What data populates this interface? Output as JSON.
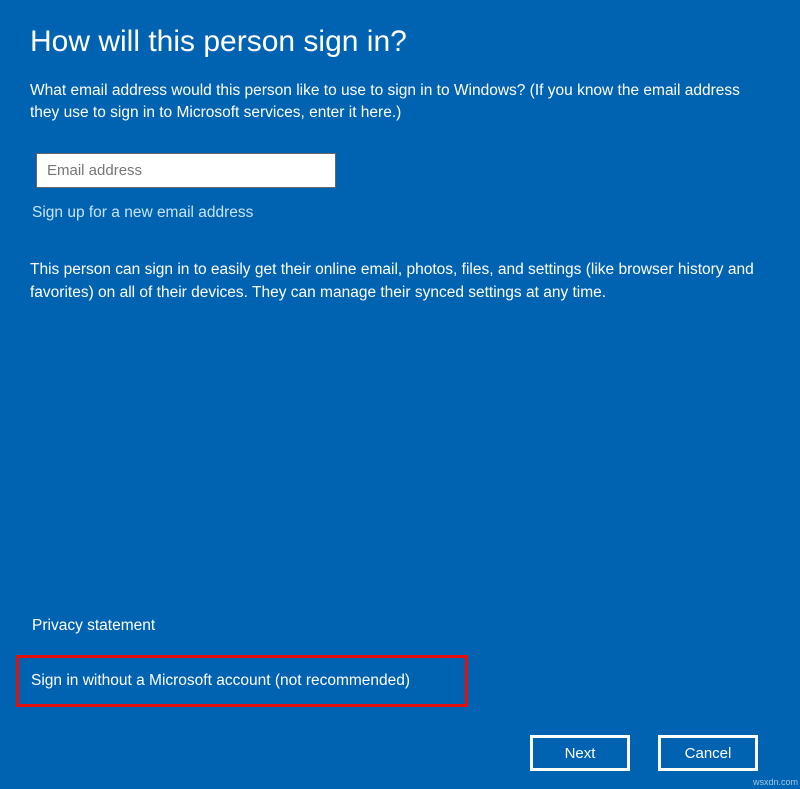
{
  "page": {
    "title": "How will this person sign in?",
    "intro": "What email address would this person like to use to sign in to Windows? (If you know the email address they use to sign in to Microsoft services, enter it here.)",
    "emailPlaceholder": "Email address",
    "signupLink": "Sign up for a new email address",
    "description": "This person can sign in to easily get their online email, photos, files, and settings (like browser history and favorites) on all of their devices. They can manage their synced settings at any time.",
    "privacyLink": "Privacy statement",
    "noMsAccountLink": "Sign in without a Microsoft account (not recommended)"
  },
  "buttons": {
    "next": "Next",
    "cancel": "Cancel"
  },
  "meta": {
    "source": "wsxdn.com"
  }
}
